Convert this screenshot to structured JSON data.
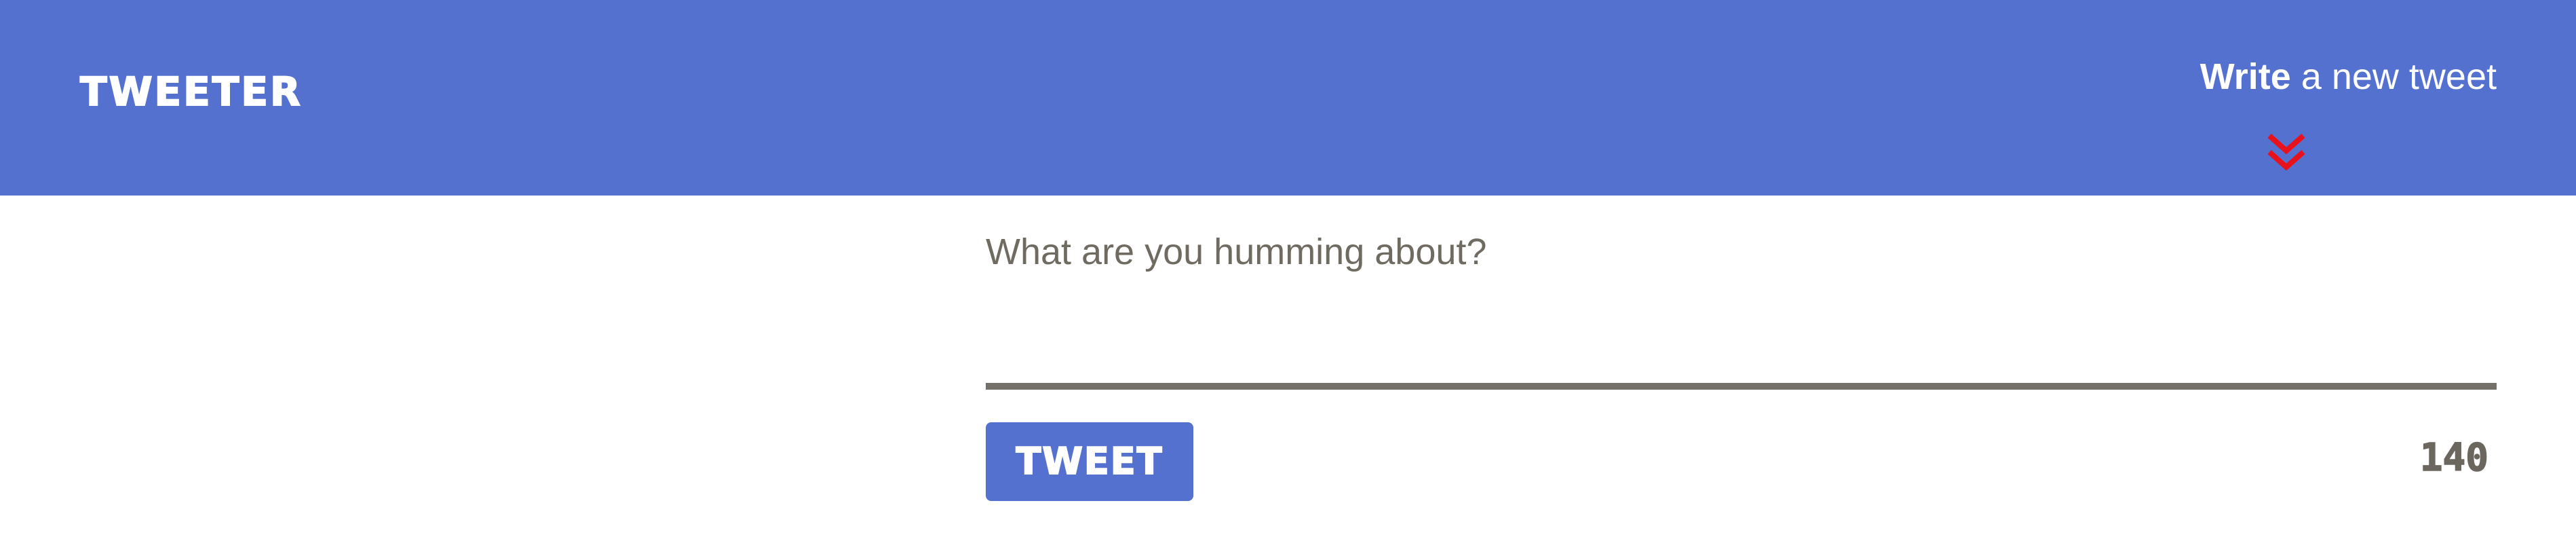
{
  "app": {
    "brand": "Tweeter"
  },
  "header": {
    "compose_toggle": {
      "bold_text": "Write",
      "rest_text": " a new tweet",
      "icon": "double-chevron-down-icon"
    }
  },
  "composer": {
    "placeholder": "What are you humming about?",
    "value": "",
    "submit_label": "Tweet",
    "char_counter": "140"
  },
  "colors": {
    "header_bg": "#5571d0",
    "button_bg": "#5571d0",
    "chevron": "#e8121c",
    "divider": "#727068",
    "counter_text": "#6b675f",
    "placeholder_text": "#6f6b61"
  }
}
